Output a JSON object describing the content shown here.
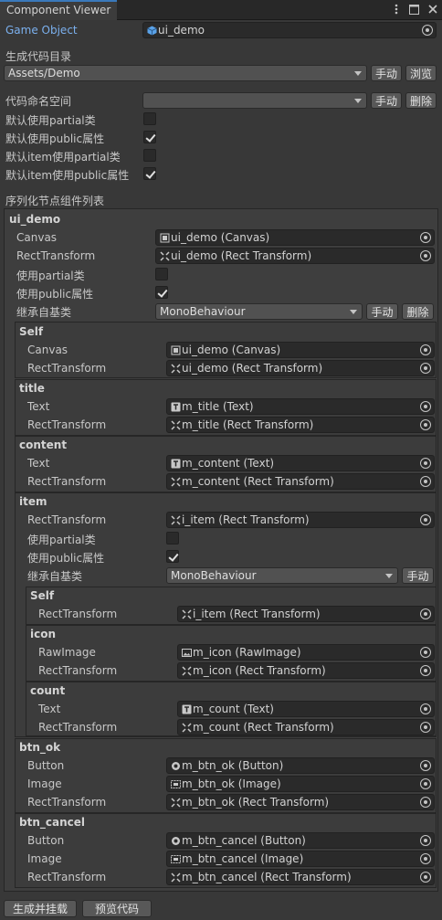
{
  "tab": {
    "title": "Component Viewer"
  },
  "game_object": {
    "label": "Game Object",
    "value": "ui_demo"
  },
  "output_dir": {
    "label": "生成代码目录",
    "value": "Assets/Demo",
    "manual_label": "手动",
    "browse_label": "浏览"
  },
  "namespace": {
    "label": "代码命名空间",
    "value": "",
    "manual_label": "手动",
    "delete_label": "删除"
  },
  "options": [
    {
      "label": "默认使用partial类",
      "checked": false
    },
    {
      "label": "默认使用public属性",
      "checked": true
    },
    {
      "label": "默认item使用partial类",
      "checked": false
    },
    {
      "label": "默认item使用public属性",
      "checked": true
    }
  ],
  "serialize_list_label": "序列化节点组件列表",
  "root": {
    "name": "ui_demo",
    "canvas": {
      "label": "Canvas",
      "value": "ui_demo (Canvas)"
    },
    "rect": {
      "label": "RectTransform",
      "value": "ui_demo (Rect Transform)"
    },
    "partial_label": "使用partial类",
    "public_label": "使用public属性",
    "base_label": "继承自基类",
    "base_value": "MonoBehaviour",
    "manual_label": "手动",
    "delete_label": "删除"
  },
  "self_group": {
    "name": "Self",
    "canvas": {
      "label": "Canvas",
      "value": "ui_demo (Canvas)"
    },
    "rect": {
      "label": "RectTransform",
      "value": "ui_demo (Rect Transform)"
    }
  },
  "title_group": {
    "name": "title",
    "text": {
      "label": "Text",
      "value": "m_title (Text)"
    },
    "rect": {
      "label": "RectTransform",
      "value": "m_title (Rect Transform)"
    }
  },
  "content_group": {
    "name": "content",
    "text": {
      "label": "Text",
      "value": "m_content (Text)"
    },
    "rect": {
      "label": "RectTransform",
      "value": "m_content (Rect Transform)"
    }
  },
  "item_group": {
    "name": "item",
    "rect": {
      "label": "RectTransform",
      "value": "i_item (Rect Transform)"
    },
    "partial_label": "使用partial类",
    "public_label": "使用public属性",
    "base_label": "继承自基类",
    "base_value": "MonoBehaviour",
    "manual_label": "手动",
    "self": {
      "name": "Self",
      "rect": {
        "label": "RectTransform",
        "value": "i_item (Rect Transform)"
      }
    },
    "icon": {
      "name": "icon",
      "rawimage": {
        "label": "RawImage",
        "value": "m_icon (RawImage)"
      },
      "rect": {
        "label": "RectTransform",
        "value": "m_icon (Rect Transform)"
      }
    },
    "count": {
      "name": "count",
      "text": {
        "label": "Text",
        "value": "m_count (Text)"
      },
      "rect": {
        "label": "RectTransform",
        "value": "m_count (Rect Transform)"
      }
    }
  },
  "btn_ok_group": {
    "name": "btn_ok",
    "button": {
      "label": "Button",
      "value": "m_btn_ok (Button)"
    },
    "image": {
      "label": "Image",
      "value": "m_btn_ok (Image)"
    },
    "rect": {
      "label": "RectTransform",
      "value": "m_btn_ok (Rect Transform)"
    }
  },
  "btn_cancel_group": {
    "name": "btn_cancel",
    "button": {
      "label": "Button",
      "value": "m_btn_cancel (Button)"
    },
    "image": {
      "label": "Image",
      "value": "m_btn_cancel (Image)"
    },
    "rect": {
      "label": "RectTransform",
      "value": "m_btn_cancel (Rect Transform)"
    }
  },
  "footer": {
    "generate_label": "生成并挂载",
    "preview_label": "预览代码"
  },
  "colors": {
    "accent": "#3a79bb",
    "label_blue": "#7bb0ee",
    "background": "#383838"
  }
}
